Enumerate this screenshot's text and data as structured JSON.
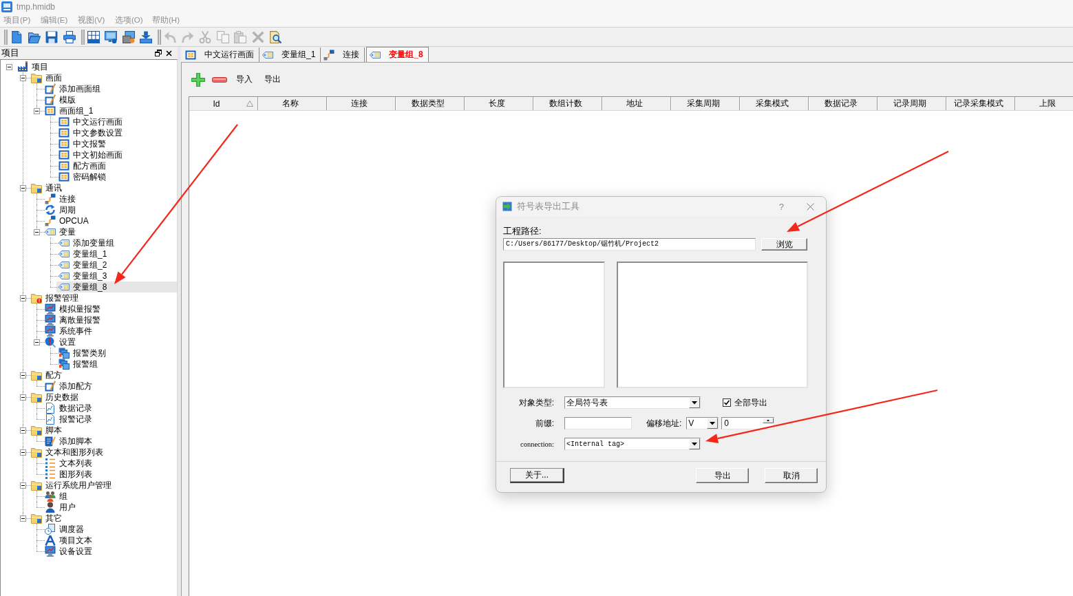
{
  "window": {
    "title": "tmp.hmidb",
    "active": false
  },
  "menu": [
    "项目(P)",
    "编辑(E)",
    "视图(V)",
    "选项(O)",
    "帮助(H)"
  ],
  "toolbar": [
    {
      "items": [
        {
          "kind": "new",
          "disabled": false
        },
        {
          "kind": "open",
          "disabled": false
        },
        {
          "kind": "save",
          "disabled": false
        },
        {
          "kind": "print",
          "disabled": false
        }
      ]
    },
    {
      "items": [
        {
          "kind": "grid",
          "disabled": false
        },
        {
          "kind": "monitor",
          "disabled": false
        },
        {
          "kind": "monitor-record",
          "disabled": false
        },
        {
          "kind": "download",
          "disabled": false
        }
      ]
    },
    {
      "items": [
        {
          "kind": "undo",
          "disabled": true
        },
        {
          "kind": "redo",
          "disabled": true
        },
        {
          "kind": "cut",
          "disabled": true
        },
        {
          "kind": "copy",
          "disabled": true
        },
        {
          "kind": "paste",
          "disabled": true
        },
        {
          "kind": "delete",
          "disabled": true
        },
        {
          "kind": "find",
          "disabled": false
        }
      ]
    }
  ],
  "sidebar": {
    "title": "项目",
    "tree": [
      {
        "label": "项目",
        "kind": "factory",
        "selected": false,
        "expanded": true,
        "children": [
          {
            "label": "画面",
            "kind": "folder",
            "selected": false,
            "expanded": true,
            "children": [
              {
                "label": "添加画面组",
                "kind": "edit",
                "selected": false
              },
              {
                "label": "模版",
                "kind": "edit",
                "selected": false
              },
              {
                "label": "画面组_1",
                "kind": "screen",
                "selected": false,
                "expanded": true,
                "children": [
                  {
                    "label": "中文运行画面",
                    "kind": "screen",
                    "selected": false
                  },
                  {
                    "label": "中文参数设置",
                    "kind": "screen",
                    "selected": false
                  },
                  {
                    "label": "中文报警",
                    "kind": "screen",
                    "selected": false
                  },
                  {
                    "label": "中文初始画面",
                    "kind": "screen",
                    "selected": false
                  },
                  {
                    "label": "配方画面",
                    "kind": "screen",
                    "selected": false
                  },
                  {
                    "label": "密码解锁",
                    "kind": "screen",
                    "selected": false
                  }
                ]
              }
            ]
          },
          {
            "label": "通讯",
            "kind": "folder",
            "selected": false,
            "expanded": true,
            "children": [
              {
                "label": "连接",
                "kind": "link",
                "selected": false
              },
              {
                "label": "周期",
                "kind": "cycle",
                "selected": false
              },
              {
                "label": "OPCUA",
                "kind": "link",
                "selected": false
              },
              {
                "label": "变量",
                "kind": "tag",
                "selected": false,
                "expanded": true,
                "children": [
                  {
                    "label": "添加变量组",
                    "kind": "tag",
                    "selected": false
                  },
                  {
                    "label": "变量组_1",
                    "kind": "tag",
                    "selected": false
                  },
                  {
                    "label": "变量组_2",
                    "kind": "tag",
                    "selected": false
                  },
                  {
                    "label": "变量组_3",
                    "kind": "tag",
                    "selected": false
                  },
                  {
                    "label": "变量组_8",
                    "kind": "tag",
                    "selected": true
                  }
                ]
              }
            ]
          },
          {
            "label": "报警管理",
            "kind": "folder-alert",
            "selected": false,
            "expanded": true,
            "children": [
              {
                "label": "模拟量报警",
                "kind": "monitor",
                "selected": false
              },
              {
                "label": "离散量报警",
                "kind": "monitor",
                "selected": false
              },
              {
                "label": "系统事件",
                "kind": "monitor",
                "selected": false
              },
              {
                "label": "设置",
                "kind": "alert",
                "selected": false,
                "expanded": true,
                "children": [
                  {
                    "label": "报警类别",
                    "kind": "messages",
                    "selected": false
                  },
                  {
                    "label": "报警组",
                    "kind": "messages",
                    "selected": false
                  }
                ]
              }
            ]
          },
          {
            "label": "配方",
            "kind": "folder",
            "selected": false,
            "expanded": true,
            "children": [
              {
                "label": "添加配方",
                "kind": "edit",
                "selected": false
              }
            ]
          },
          {
            "label": "历史数据",
            "kind": "folder",
            "selected": false,
            "expanded": true,
            "children": [
              {
                "label": "数据记录",
                "kind": "document",
                "selected": false
              },
              {
                "label": "报警记录",
                "kind": "document",
                "selected": false
              }
            ]
          },
          {
            "label": "脚本",
            "kind": "folder",
            "selected": false,
            "expanded": true,
            "children": [
              {
                "label": "添加脚本",
                "kind": "script",
                "selected": false
              }
            ]
          },
          {
            "label": "文本和图形列表",
            "kind": "folder",
            "selected": false,
            "expanded": true,
            "children": [
              {
                "label": "文本列表",
                "kind": "list",
                "selected": false
              },
              {
                "label": "图形列表",
                "kind": "list",
                "selected": false
              }
            ]
          },
          {
            "label": "运行系统用户管理",
            "kind": "folder",
            "selected": false,
            "expanded": true,
            "children": [
              {
                "label": "组",
                "kind": "users",
                "selected": false
              },
              {
                "label": "用户",
                "kind": "user",
                "selected": false
              }
            ]
          },
          {
            "label": "其它",
            "kind": "folder",
            "selected": false,
            "expanded": true,
            "children": [
              {
                "label": "调度器",
                "kind": "clock",
                "selected": false
              },
              {
                "label": "项目文本",
                "kind": "font",
                "selected": false
              },
              {
                "label": "设备设置",
                "kind": "monitor",
                "selected": false
              }
            ]
          }
        ]
      }
    ]
  },
  "tabs": [
    {
      "label": "中文运行画面",
      "kind": "screen",
      "selected": false
    },
    {
      "label": "变量组_1",
      "kind": "tag",
      "selected": false
    },
    {
      "label": "连接",
      "kind": "link",
      "selected": false
    },
    {
      "label": "变量组_8",
      "kind": "tag",
      "selected": true
    }
  ],
  "table_toolbar": [
    {
      "kind": "add"
    },
    {
      "kind": "remove"
    },
    {
      "kind": "text",
      "label": "导入"
    },
    {
      "kind": "text",
      "label": "导出"
    }
  ],
  "table": {
    "columns": [
      {
        "label": "Id",
        "sorted": true
      },
      {
        "label": "名称",
        "sorted": false
      },
      {
        "label": "连接",
        "sorted": false
      },
      {
        "label": "数据类型",
        "sorted": false
      },
      {
        "label": "长度",
        "sorted": false
      },
      {
        "label": "数组计数",
        "sorted": false
      },
      {
        "label": "地址",
        "sorted": false
      },
      {
        "label": "采集周期",
        "sorted": false
      },
      {
        "label": "采集模式",
        "sorted": false
      },
      {
        "label": "数据记录",
        "sorted": false
      },
      {
        "label": "记录周期",
        "sorted": false
      },
      {
        "label": "记录采集模式",
        "sorted": false
      },
      {
        "label": "上限",
        "sorted": false
      }
    ]
  },
  "dialog": {
    "title": "符号表导出工具",
    "active": false,
    "help": "?",
    "path": {
      "label": "工程路径:",
      "value": "C:/Users/86177/Desktop/锯竹机/Project2"
    },
    "browse_button": "浏览",
    "object_type": {
      "label": "对象类型:",
      "value": "全局符号表"
    },
    "export_all": {
      "label": "全部导出",
      "checked": true
    },
    "prefix": {
      "label": "前缀:"
    },
    "offset": {
      "label": "偏移地址:",
      "area": "V",
      "value": "0"
    },
    "connection": {
      "label": "connection:",
      "value": "<Internal tag>"
    },
    "buttons": [
      {
        "label": "关于...",
        "default": true
      },
      {
        "label": "导出",
        "default": false
      },
      {
        "label": "取消",
        "default": false
      }
    ]
  },
  "annotations": [
    {
      "kind": "arrow"
    },
    {
      "kind": "arrow"
    },
    {
      "kind": "arrow"
    }
  ]
}
